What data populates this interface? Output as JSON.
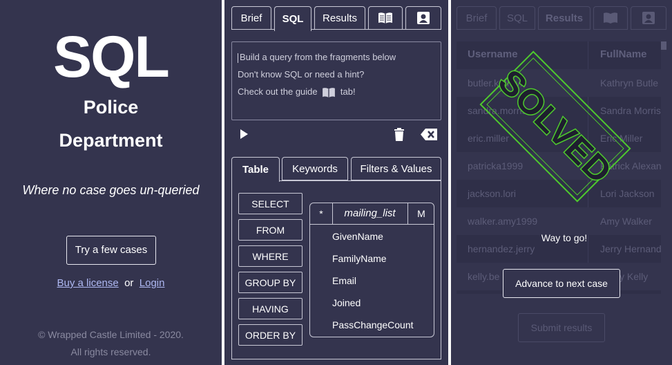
{
  "landing": {
    "logo": "SQL",
    "subtitle_line1": "Police",
    "subtitle_line2": "Department",
    "tagline": "Where no case goes un-queried",
    "try_button": "Try a few cases",
    "buy_link": "Buy a license",
    "or_text": "or",
    "login_link": "Login",
    "copyright_line1": "© Wrapped Castle Limited - 2020.",
    "copyright_line2": "All rights reserved."
  },
  "editor_panel": {
    "tabs": [
      {
        "label": "Brief"
      },
      {
        "label": "SQL"
      },
      {
        "label": "Results"
      },
      {
        "icon": "book-icon"
      },
      {
        "icon": "contact-card-icon"
      }
    ],
    "active_tab": "SQL",
    "editor_lines": [
      "Build a query from the fragments below",
      "Don't know SQL or need a hint?",
      "Check out the guide",
      "tab!"
    ],
    "toolbar_icons": [
      "play-icon",
      "trash-icon",
      "backspace-icon"
    ],
    "subtabs": [
      "Table",
      "Keywords",
      "Filters & Values"
    ],
    "active_subtab": "Table",
    "keywords": [
      "SELECT",
      "FROM",
      "WHERE",
      "GROUP BY",
      "HAVING",
      "ORDER BY"
    ],
    "table": {
      "star": "*",
      "name": "mailing_list",
      "toggle": "M",
      "columns": [
        "GivenName",
        "FamilyName",
        "Email",
        "Joined",
        "PassChangeCount"
      ]
    }
  },
  "results_panel": {
    "tabs": [
      "Brief",
      "SQL",
      "Results"
    ],
    "headers": [
      "Username",
      "FullName"
    ],
    "rows": [
      [
        "butler.kathryn",
        "Kathryn Butle"
      ],
      [
        "sandra.morris",
        "Sandra Morris"
      ],
      [
        "eric.miller",
        "Eric Miller"
      ],
      [
        "patricka1999",
        "Patrick Alexan"
      ],
      [
        "jackson.lori",
        "Lori Jackson"
      ],
      [
        "walker.amy1999",
        "Amy Walker"
      ],
      [
        "hernandez.jerry",
        "Jerry Hernand"
      ],
      [
        "kelly.be",
        "y Kelly"
      ]
    ],
    "stamp": "SOLVED",
    "message": "Way to go!",
    "advance_button": "Advance to next case",
    "submit_button": "Submit results",
    "colors": {
      "stamp": "#4ecb2d",
      "panel_bg": "#34344e"
    }
  }
}
